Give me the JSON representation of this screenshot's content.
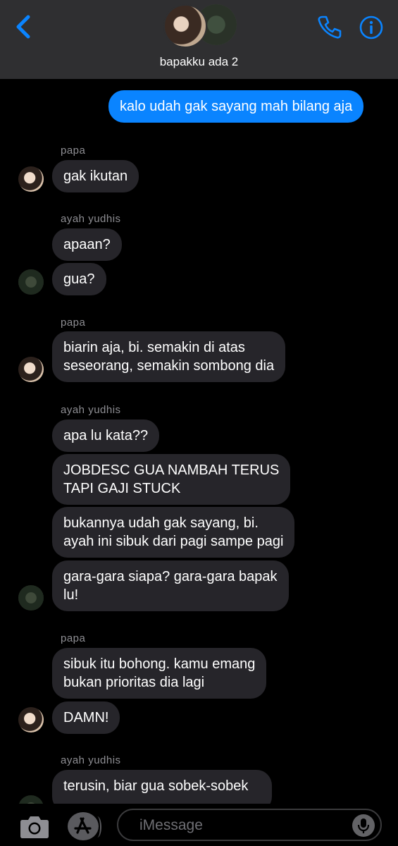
{
  "header": {
    "group_name": "bapakku ada 2",
    "back_icon": "chevron-left-icon",
    "call_icon": "phone-icon",
    "info_icon": "info-icon",
    "accent": "#0a84ff"
  },
  "messages": [
    {
      "type": "outgoing",
      "text": "kalo udah gak sayang mah bilang aja"
    },
    {
      "type": "sender",
      "text": "papa"
    },
    {
      "type": "incoming",
      "text": "gak ikutan"
    },
    {
      "type": "sender",
      "text": "ayah yudhis"
    },
    {
      "type": "incoming",
      "text": "apaan?"
    },
    {
      "type": "incoming",
      "text": "gua?"
    },
    {
      "type": "sender",
      "text": "papa"
    },
    {
      "type": "incoming",
      "lines": [
        "biarin aja, bi. semakin di atas",
        "seseorang, semakin sombong dia"
      ]
    },
    {
      "type": "sender",
      "text": "ayah yudhis"
    },
    {
      "type": "incoming",
      "text": "apa lu kata??"
    },
    {
      "type": "incoming",
      "lines": [
        "JOBDESC GUA NAMBAH TERUS",
        "TAPI GAJI STUCK"
      ]
    },
    {
      "type": "incoming",
      "lines": [
        "bukannya udah gak sayang, bi.",
        "ayah ini sibuk dari pagi sampe pagi"
      ]
    },
    {
      "type": "incoming",
      "lines": [
        "gara-gara siapa? gara-gara bapak",
        "lu!"
      ]
    },
    {
      "type": "sender",
      "text": "papa"
    },
    {
      "type": "incoming",
      "lines": [
        "sibuk itu bohong. kamu emang",
        "bukan prioritas dia lagi"
      ]
    },
    {
      "type": "incoming",
      "text": "DAMN!"
    },
    {
      "type": "sender",
      "text": "ayah yudhis"
    },
    {
      "type": "incoming",
      "lines": [
        "terusin, biar gua sobek-sobek"
      ]
    }
  ],
  "composer": {
    "placeholder": "iMessage",
    "camera_icon": "camera-icon",
    "apps_icon": "app-store-icon",
    "mic_icon": "microphone-icon"
  }
}
